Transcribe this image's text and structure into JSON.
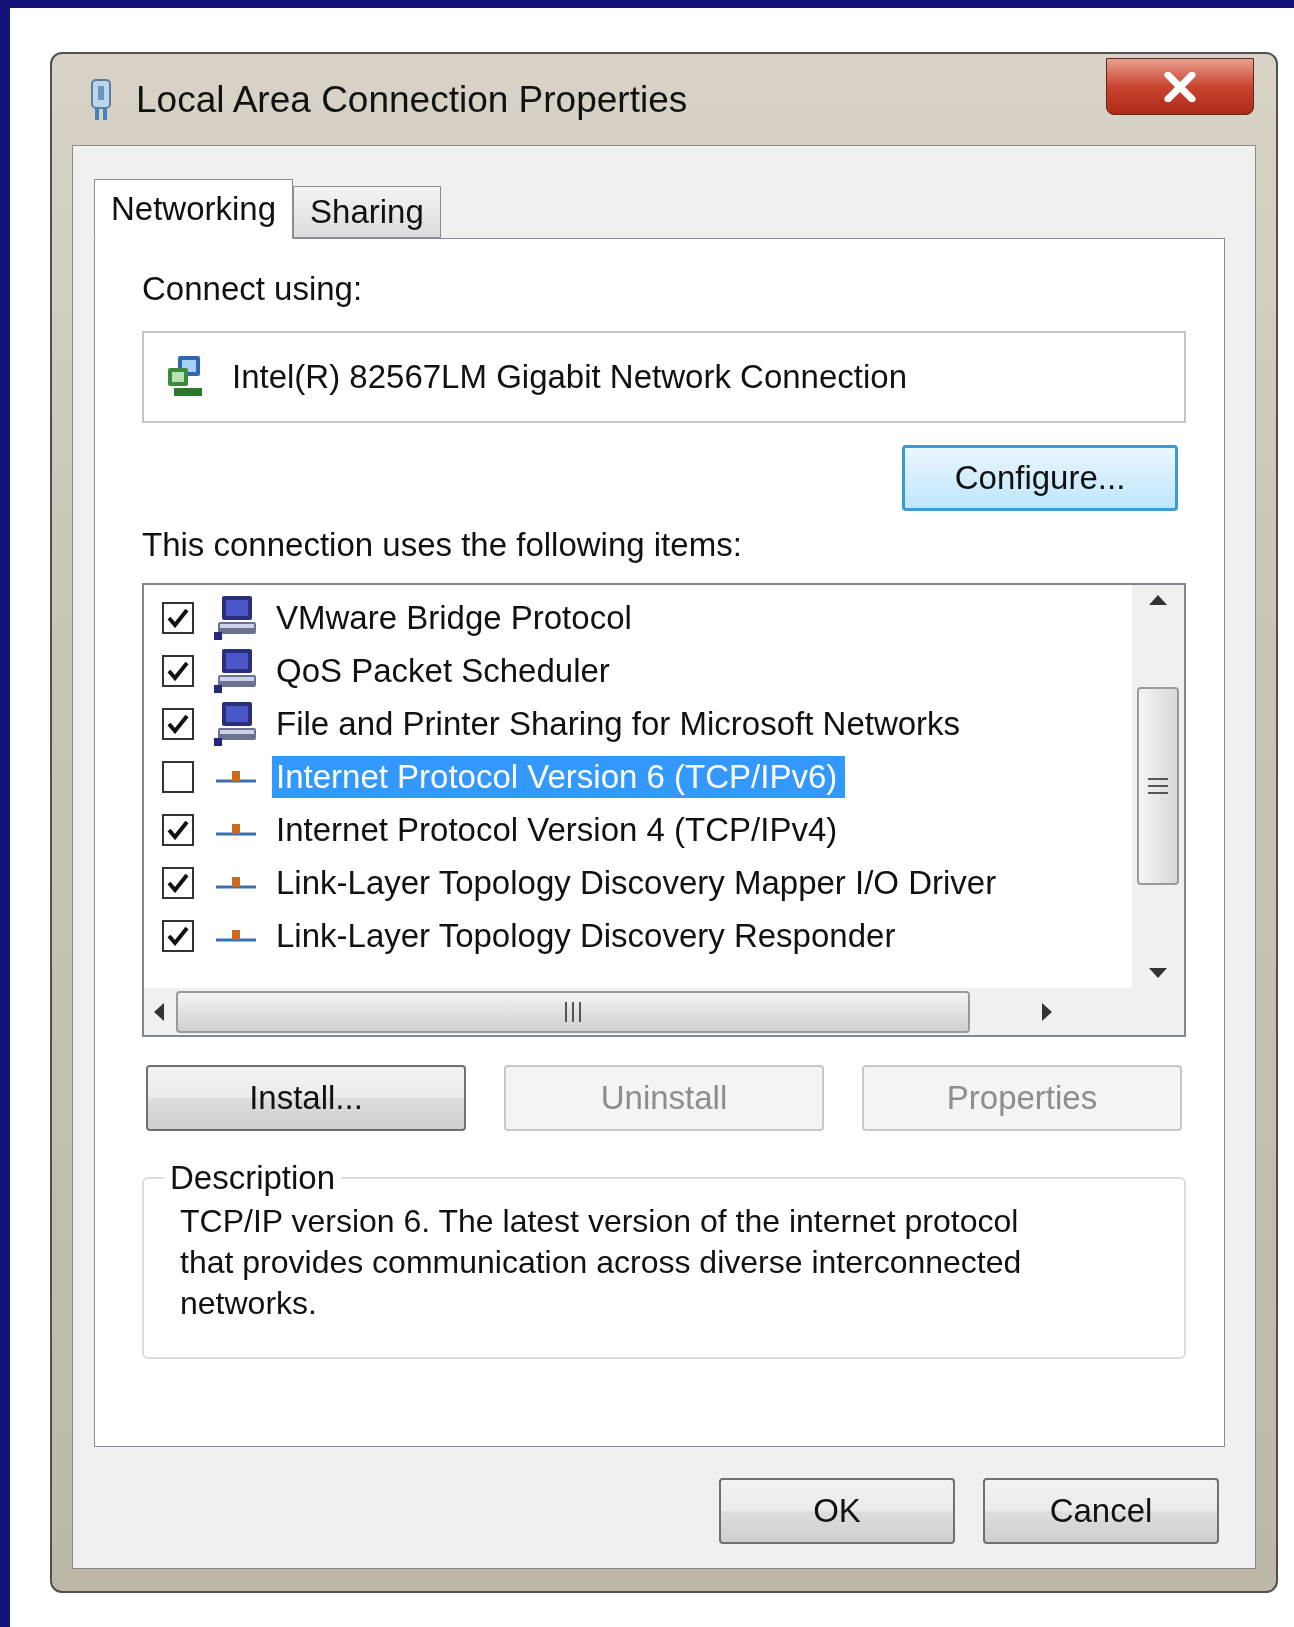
{
  "window": {
    "title": "Local Area Connection Properties"
  },
  "tabs": [
    {
      "label": "Networking",
      "selected": true
    },
    {
      "label": "Sharing",
      "selected": false
    }
  ],
  "connect_using": {
    "label": "Connect using:",
    "adapter": "Intel(R) 82567LM Gigabit Network Connection"
  },
  "configure_button": "Configure...",
  "items_label": "This connection uses the following items:",
  "items": [
    {
      "label": "VMware Bridge Protocol",
      "kind": "service",
      "checked": true,
      "selected": false
    },
    {
      "label": "QoS Packet Scheduler",
      "kind": "service",
      "checked": true,
      "selected": false
    },
    {
      "label": "File and Printer Sharing for Microsoft Networks",
      "kind": "service",
      "checked": true,
      "selected": false
    },
    {
      "label": "Internet Protocol Version 6 (TCP/IPv6)",
      "kind": "protocol",
      "checked": false,
      "selected": true
    },
    {
      "label": "Internet Protocol Version 4 (TCP/IPv4)",
      "kind": "protocol",
      "checked": true,
      "selected": false
    },
    {
      "label": "Link-Layer Topology Discovery Mapper I/O Driver",
      "kind": "protocol",
      "checked": true,
      "selected": false
    },
    {
      "label": "Link-Layer Topology Discovery Responder",
      "kind": "protocol",
      "checked": true,
      "selected": false
    }
  ],
  "item_buttons": [
    {
      "label": "Install...",
      "disabled": false
    },
    {
      "label": "Uninstall",
      "disabled": true
    },
    {
      "label": "Properties",
      "disabled": true
    }
  ],
  "description": {
    "label": "Description",
    "text": "TCP/IP version 6. The latest version of the internet protocol that provides communication across diverse interconnected networks."
  },
  "footer_buttons": [
    {
      "label": "OK"
    },
    {
      "label": "Cancel"
    }
  ]
}
